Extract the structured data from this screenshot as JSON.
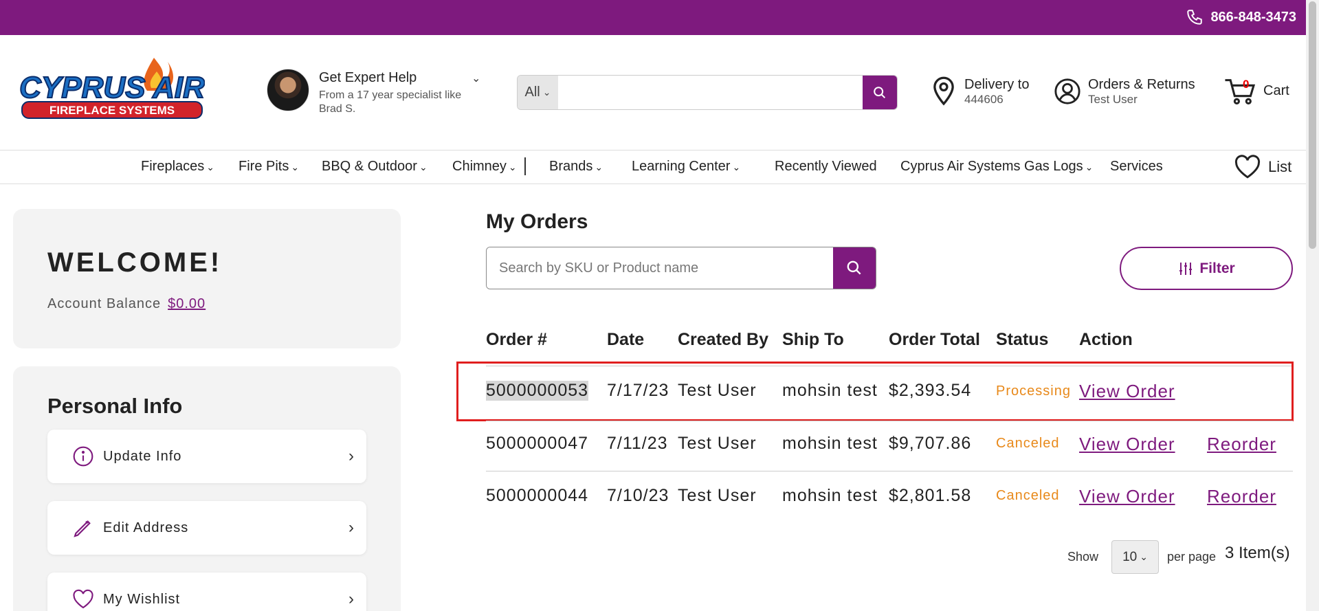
{
  "topbar": {
    "phone": "866-848-3473",
    "phone_icon": "phone-icon",
    "color": "#7e1a7e"
  },
  "header": {
    "logo": {
      "line1": "CYPRUS AIR",
      "line2": "FIREPLACE SYSTEMS"
    },
    "expert": {
      "title": "Get Expert Help",
      "subtitle": "From a 17 year specialist like Brad S."
    },
    "search": {
      "scope": "All",
      "placeholder": ""
    },
    "delivery": {
      "label": "Delivery to",
      "zip": "444606"
    },
    "account": {
      "label": "Orders & Returns",
      "user": "Test User"
    },
    "cart": {
      "label": "Cart",
      "count": "0"
    }
  },
  "nav": {
    "items": [
      "Fireplaces",
      "Fire Pits",
      "BBQ & Outdoor",
      "Chimney",
      "Brands",
      "Learning Center",
      "Recently Viewed",
      "Cyprus Air Systems Gas Logs",
      "Services"
    ],
    "list_label": "List"
  },
  "sidebar": {
    "welcome": "WELCOME!",
    "balance_label": "Account Balance",
    "balance_value": "$0.00",
    "personal_info_title": "Personal Info",
    "items": [
      "Update Info",
      "Edit Address",
      "My Wishlist"
    ]
  },
  "orders": {
    "title": "My Orders",
    "search_placeholder": "Search by SKU or Product name",
    "filter_label": "Filter",
    "columns": [
      "Order #",
      "Date",
      "Created By",
      "Ship To",
      "Order Total",
      "Status",
      "Action"
    ],
    "rows": [
      {
        "order": "5000000053",
        "date": "7/17/23",
        "created_by": "Test User",
        "ship_to": "mohsin test",
        "total": "$2,393.54",
        "status": "Processing",
        "view": "View Order",
        "reorder": ""
      },
      {
        "order": "5000000047",
        "date": "7/11/23",
        "created_by": "Test User",
        "ship_to": "mohsin test",
        "total": "$9,707.86",
        "status": "Canceled",
        "view": "View Order",
        "reorder": "Reorder"
      },
      {
        "order": "5000000044",
        "date": "7/10/23",
        "created_by": "Test User",
        "ship_to": "mohsin test",
        "total": "$2,801.58",
        "status": "Canceled",
        "view": "View Order",
        "reorder": "Reorder"
      }
    ],
    "pager": {
      "show": "Show",
      "per_page_value": "10",
      "per_page": "per page",
      "count": "3 Item(s)"
    }
  }
}
